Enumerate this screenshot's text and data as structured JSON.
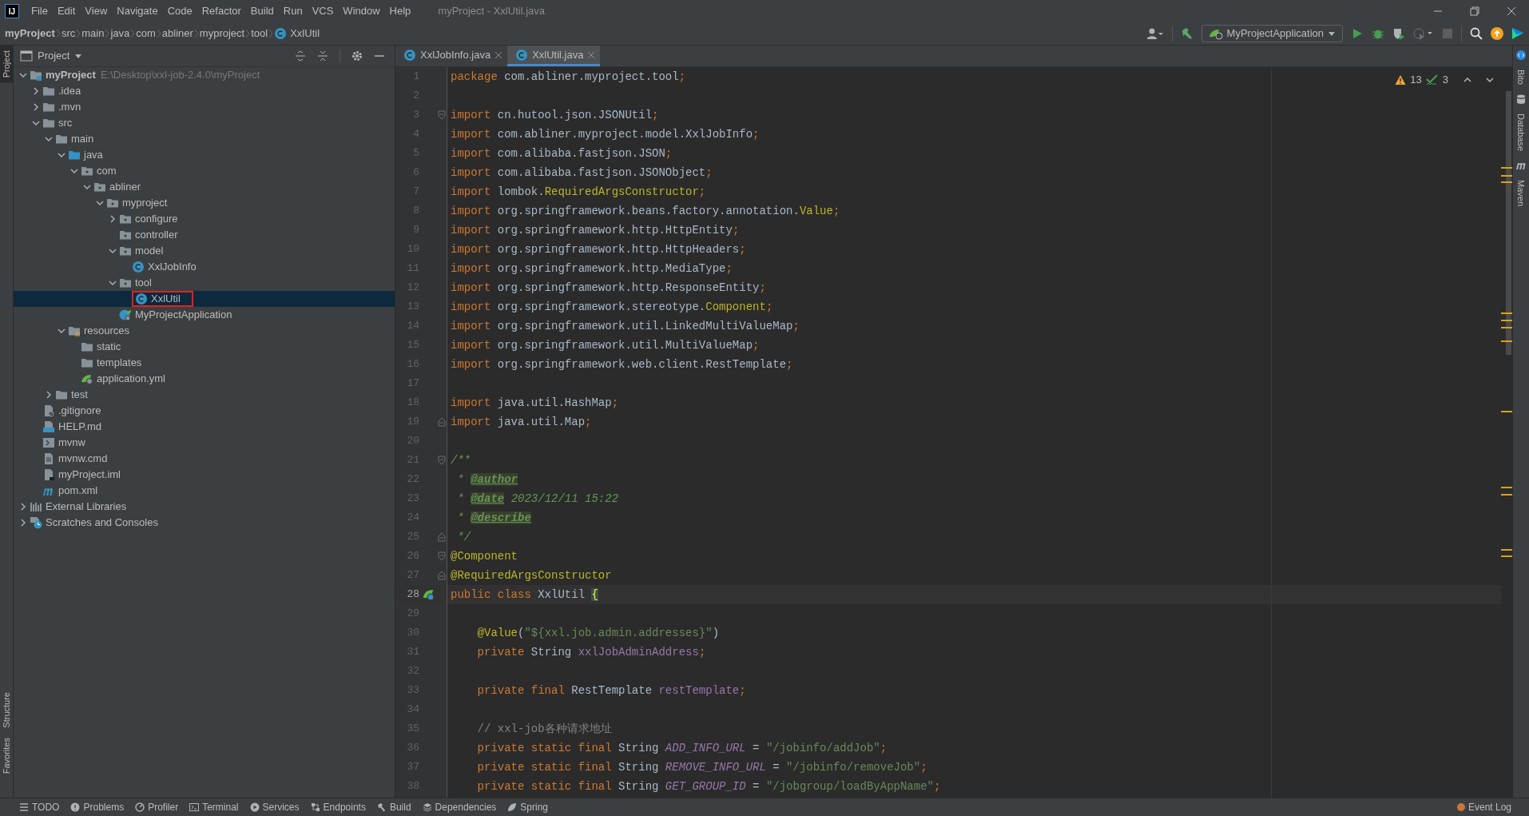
{
  "window": {
    "logo": "IJ",
    "title": "myProject - XxlUtil.java"
  },
  "menu": [
    "File",
    "Edit",
    "View",
    "Navigate",
    "Code",
    "Refactor",
    "Build",
    "Run",
    "VCS",
    "Window",
    "Help"
  ],
  "breadcrumbs": [
    {
      "label": "myProject",
      "kind": "project"
    },
    {
      "label": "src",
      "kind": "folder"
    },
    {
      "label": "main",
      "kind": "folder"
    },
    {
      "label": "java",
      "kind": "folder"
    },
    {
      "label": "com",
      "kind": "folder"
    },
    {
      "label": "abliner",
      "kind": "folder"
    },
    {
      "label": "myproject",
      "kind": "folder"
    },
    {
      "label": "tool",
      "kind": "folder"
    },
    {
      "label": "XxlUtil",
      "kind": "class"
    }
  ],
  "run_config": {
    "label": "MyProjectApplication"
  },
  "left_stripe_top": [
    {
      "label": "Project",
      "selected": true
    }
  ],
  "left_stripe_bottom": [
    {
      "label": "Structure",
      "selected": false
    },
    {
      "label": "Favorites",
      "selected": false
    }
  ],
  "right_stripe": [
    {
      "label": "Bito",
      "kind": "bito"
    },
    {
      "label": "Database",
      "kind": "database"
    },
    {
      "label": "Maven",
      "kind": "maven"
    }
  ],
  "project_panel": {
    "title": "Project",
    "tree": [
      {
        "label": "myProject",
        "kind": "module",
        "hint": "E:\\Desktop\\xxl-job-2.4.0\\myProject",
        "expanded": true,
        "selected": false,
        "boxed": false,
        "children": [
          {
            "label": ".idea",
            "kind": "folder",
            "expanded": false,
            "selected": false,
            "boxed": false
          },
          {
            "label": ".mvn",
            "kind": "folder",
            "expanded": false,
            "selected": false,
            "boxed": false
          },
          {
            "label": "src",
            "kind": "folder",
            "expanded": true,
            "selected": false,
            "boxed": false,
            "children": [
              {
                "label": "main",
                "kind": "folder",
                "expanded": true,
                "selected": false,
                "boxed": false,
                "children": [
                  {
                    "label": "java",
                    "kind": "source",
                    "expanded": true,
                    "selected": false,
                    "boxed": false,
                    "children": [
                      {
                        "label": "com",
                        "kind": "package",
                        "expanded": true,
                        "selected": false,
                        "boxed": false,
                        "children": [
                          {
                            "label": "abliner",
                            "kind": "package",
                            "expanded": true,
                            "selected": false,
                            "boxed": false,
                            "children": [
                              {
                                "label": "myproject",
                                "kind": "package",
                                "expanded": true,
                                "selected": false,
                                "boxed": false,
                                "children": [
                                  {
                                    "label": "configure",
                                    "kind": "package",
                                    "expanded": false,
                                    "selected": false,
                                    "boxed": false
                                  },
                                  {
                                    "label": "controller",
                                    "kind": "package",
                                    "selected": false,
                                    "boxed": false
                                  },
                                  {
                                    "label": "model",
                                    "kind": "package",
                                    "expanded": true,
                                    "selected": false,
                                    "boxed": false,
                                    "children": [
                                      {
                                        "label": "XxlJobInfo",
                                        "kind": "class",
                                        "selected": false,
                                        "boxed": false
                                      }
                                    ]
                                  },
                                  {
                                    "label": "tool",
                                    "kind": "package",
                                    "expanded": true,
                                    "selected": false,
                                    "boxed": false,
                                    "children": [
                                      {
                                        "label": "XxlUtil",
                                        "kind": "class",
                                        "selected": true,
                                        "boxed": true
                                      }
                                    ]
                                  },
                                  {
                                    "label": "MyProjectApplication",
                                    "kind": "spring",
                                    "selected": false,
                                    "boxed": false
                                  }
                                ]
                              }
                            ]
                          }
                        ]
                      }
                    ]
                  },
                  {
                    "label": "resources",
                    "kind": "resources",
                    "expanded": true,
                    "selected": false,
                    "boxed": false,
                    "children": [
                      {
                        "label": "static",
                        "kind": "folder",
                        "selected": false,
                        "boxed": false
                      },
                      {
                        "label": "templates",
                        "kind": "folder",
                        "selected": false,
                        "boxed": false
                      },
                      {
                        "label": "application.yml",
                        "kind": "yml",
                        "selected": false,
                        "boxed": false
                      }
                    ]
                  }
                ]
              },
              {
                "label": "test",
                "kind": "folder",
                "expanded": false,
                "selected": false,
                "boxed": false
              }
            ]
          },
          {
            "label": ".gitignore",
            "kind": "ignore",
            "selected": false,
            "boxed": false
          },
          {
            "label": "HELP.md",
            "kind": "markdown",
            "selected": false,
            "boxed": false
          },
          {
            "label": "mvnw",
            "kind": "script",
            "selected": false,
            "boxed": false
          },
          {
            "label": "mvnw.cmd",
            "kind": "text",
            "selected": false,
            "boxed": false
          },
          {
            "label": "myProject.iml",
            "kind": "iml",
            "selected": false,
            "boxed": false
          },
          {
            "label": "pom.xml",
            "kind": "maven",
            "selected": false,
            "boxed": false
          }
        ]
      },
      {
        "label": "External Libraries",
        "kind": "libraries",
        "expanded": false,
        "selected": false,
        "boxed": false
      },
      {
        "label": "Scratches and Consoles",
        "kind": "scratches",
        "expanded": false,
        "selected": false,
        "boxed": false
      }
    ]
  },
  "editor": {
    "tabs": [
      {
        "label": "XxlJobInfo.java",
        "selected": false
      },
      {
        "label": "XxlUtil.java",
        "selected": true
      }
    ],
    "warnings": "13",
    "typos": "3",
    "lines": [
      {
        "number": "1",
        "current": false,
        "tokens": [
          {
            "text": "package ",
            "kind": "keyword"
          },
          {
            "text": "com.abliner.myproject.tool",
            "kind": "plain"
          },
          {
            "text": ";",
            "kind": "keyword"
          }
        ]
      },
      {
        "number": "2",
        "current": false,
        "kind": "code"
      },
      {
        "number": "3",
        "current": false,
        "kind": "fold-start",
        "tokens": [
          {
            "text": "import ",
            "kind": "keyword"
          },
          {
            "text": "cn.hutool.json.JSONUtil",
            "kind": "plain"
          },
          {
            "text": ";",
            "kind": "keyword"
          }
        ]
      },
      {
        "number": "4",
        "current": false,
        "tokens": [
          {
            "text": "import ",
            "kind": "keyword"
          },
          {
            "text": "com.abliner.myproject.model.XxlJobInfo",
            "kind": "plain"
          },
          {
            "text": ";",
            "kind": "keyword"
          }
        ]
      },
      {
        "number": "5",
        "current": false,
        "tokens": [
          {
            "text": "import ",
            "kind": "keyword"
          },
          {
            "text": "com.alibaba.fastjson.JSON",
            "kind": "plain"
          },
          {
            "text": ";",
            "kind": "keyword"
          }
        ]
      },
      {
        "number": "6",
        "current": false,
        "tokens": [
          {
            "text": "import ",
            "kind": "keyword"
          },
          {
            "text": "com.alibaba.fastjson.JSONObject",
            "kind": "plain"
          },
          {
            "text": ";",
            "kind": "keyword"
          }
        ]
      },
      {
        "number": "7",
        "current": false,
        "tokens": [
          {
            "text": "import ",
            "kind": "keyword"
          },
          {
            "text": "lombok.",
            "kind": "plain"
          },
          {
            "text": "RequiredArgsConstructor",
            "kind": "annotation"
          },
          {
            "text": ";",
            "kind": "keyword"
          }
        ]
      },
      {
        "number": "8",
        "current": false,
        "tokens": [
          {
            "text": "import ",
            "kind": "keyword"
          },
          {
            "text": "org.springframework.beans.factory.annotation.",
            "kind": "plain"
          },
          {
            "text": "Value",
            "kind": "annotation"
          },
          {
            "text": ";",
            "kind": "keyword"
          }
        ]
      },
      {
        "number": "9",
        "current": false,
        "tokens": [
          {
            "text": "import ",
            "kind": "keyword"
          },
          {
            "text": "org.springframework.http.HttpEntity",
            "kind": "plain"
          },
          {
            "text": ";",
            "kind": "keyword"
          }
        ]
      },
      {
        "number": "10",
        "current": false,
        "tokens": [
          {
            "text": "import ",
            "kind": "keyword"
          },
          {
            "text": "org.springframework.http.HttpHeaders",
            "kind": "plain"
          },
          {
            "text": ";",
            "kind": "keyword"
          }
        ]
      },
      {
        "number": "11",
        "current": false,
        "tokens": [
          {
            "text": "import ",
            "kind": "keyword"
          },
          {
            "text": "org.springframework.http.MediaType",
            "kind": "plain"
          },
          {
            "text": ";",
            "kind": "keyword"
          }
        ]
      },
      {
        "number": "12",
        "current": false,
        "tokens": [
          {
            "text": "import ",
            "kind": "keyword"
          },
          {
            "text": "org.springframework.http.ResponseEntity",
            "kind": "plain"
          },
          {
            "text": ";",
            "kind": "keyword"
          }
        ]
      },
      {
        "number": "13",
        "current": false,
        "tokens": [
          {
            "text": "import ",
            "kind": "keyword"
          },
          {
            "text": "org.springframework.stereotype.",
            "kind": "plain"
          },
          {
            "text": "Component",
            "kind": "annotation"
          },
          {
            "text": ";",
            "kind": "keyword"
          }
        ]
      },
      {
        "number": "14",
        "current": false,
        "tokens": [
          {
            "text": "import ",
            "kind": "keyword"
          },
          {
            "text": "org.springframework.util.LinkedMultiValueMap",
            "kind": "plain"
          },
          {
            "text": ";",
            "kind": "keyword"
          }
        ]
      },
      {
        "number": "15",
        "current": false,
        "tokens": [
          {
            "text": "import ",
            "kind": "keyword"
          },
          {
            "text": "org.springframework.util.MultiValueMap",
            "kind": "plain"
          },
          {
            "text": ";",
            "kind": "keyword"
          }
        ]
      },
      {
        "number": "16",
        "current": false,
        "tokens": [
          {
            "text": "import ",
            "kind": "keyword"
          },
          {
            "text": "org.springframework.web.client.RestTemplate",
            "kind": "plain"
          },
          {
            "text": ";",
            "kind": "keyword"
          }
        ]
      },
      {
        "number": "17",
        "current": false,
        "kind": "code"
      },
      {
        "number": "18",
        "current": false,
        "tokens": [
          {
            "text": "import ",
            "kind": "keyword"
          },
          {
            "text": "java.util.HashMap",
            "kind": "plain"
          },
          {
            "text": ";",
            "kind": "keyword"
          }
        ]
      },
      {
        "number": "19",
        "current": false,
        "kind": "fold-end",
        "tokens": [
          {
            "text": "import ",
            "kind": "keyword"
          },
          {
            "text": "java.util.Map",
            "kind": "plain"
          },
          {
            "text": ";",
            "kind": "keyword"
          }
        ]
      },
      {
        "number": "20",
        "current": false,
        "kind": "code"
      },
      {
        "number": "21",
        "current": false,
        "kind": "fold-start",
        "tokens": [
          {
            "text": "/**",
            "kind": "doc"
          }
        ]
      },
      {
        "number": "22",
        "current": false,
        "tokens": [
          {
            "text": " * ",
            "kind": "doc"
          },
          {
            "text": "@author",
            "kind": "doctag"
          }
        ]
      },
      {
        "number": "23",
        "current": false,
        "tokens": [
          {
            "text": " * ",
            "kind": "doc"
          },
          {
            "text": "@date",
            "kind": "doctag"
          },
          {
            "text": " 2023/12/11 15:22",
            "kind": "doc"
          }
        ]
      },
      {
        "number": "24",
        "current": false,
        "tokens": [
          {
            "text": " * ",
            "kind": "doc"
          },
          {
            "text": "@describe",
            "kind": "doctag"
          }
        ]
      },
      {
        "number": "25",
        "current": false,
        "kind": "fold-end",
        "tokens": [
          {
            "text": " */",
            "kind": "doc"
          }
        ]
      },
      {
        "number": "26",
        "current": false,
        "kind": "fold-start",
        "tokens": [
          {
            "text": "@Component",
            "kind": "annotation"
          }
        ]
      },
      {
        "number": "27",
        "current": false,
        "kind": "fold-end",
        "tokens": [
          {
            "text": "@RequiredArgsConstructor",
            "kind": "annotation"
          }
        ]
      },
      {
        "number": "28",
        "current": true,
        "kind": "bean",
        "tokens": [
          {
            "text": "public class ",
            "kind": "keyword"
          },
          {
            "text": "XxlUtil ",
            "kind": "plain"
          },
          {
            "text": "{",
            "kind": "brace"
          }
        ]
      },
      {
        "number": "29",
        "current": false,
        "kind": "code"
      },
      {
        "number": "30",
        "current": false,
        "kind": "code",
        "tokens": [
          {
            "text": "    @Value",
            "kind": "annotation"
          },
          {
            "text": "(",
            "kind": "plain"
          },
          {
            "text": "\"${xxl.job.admin.addresses}\"",
            "kind": "string"
          },
          {
            "text": ")",
            "kind": "plain"
          }
        ]
      },
      {
        "number": "31",
        "current": false,
        "tokens": [
          {
            "text": "    private ",
            "kind": "keyword"
          },
          {
            "text": "String ",
            "kind": "plain"
          },
          {
            "text": "xxlJobAdminAddress",
            "kind": "field"
          },
          {
            "text": ";",
            "kind": "keyword"
          }
        ]
      },
      {
        "number": "32",
        "current": false,
        "kind": "code"
      },
      {
        "number": "33",
        "current": false,
        "tokens": [
          {
            "text": "    private final ",
            "kind": "keyword"
          },
          {
            "text": "RestTemplate ",
            "kind": "plain"
          },
          {
            "text": "restTemplate",
            "kind": "field"
          },
          {
            "text": ";",
            "kind": "keyword"
          }
        ]
      },
      {
        "number": "34",
        "current": false,
        "kind": "code"
      },
      {
        "number": "35",
        "current": false,
        "tokens": [
          {
            "text": "    // xxl-job各种请求地址",
            "kind": "comment"
          }
        ]
      },
      {
        "number": "36",
        "current": false,
        "tokens": [
          {
            "text": "    private static final ",
            "kind": "keyword"
          },
          {
            "text": "String ",
            "kind": "plain"
          },
          {
            "text": "ADD_INFO_URL",
            "kind": "constant"
          },
          {
            "text": " = ",
            "kind": "plain"
          },
          {
            "text": "\"/jobinfo/addJob\"",
            "kind": "string"
          },
          {
            "text": ";",
            "kind": "keyword"
          }
        ]
      },
      {
        "number": "37",
        "current": false,
        "tokens": [
          {
            "text": "    private static final ",
            "kind": "keyword"
          },
          {
            "text": "String ",
            "kind": "plain"
          },
          {
            "text": "REMOVE_INFO_URL",
            "kind": "constant"
          },
          {
            "text": " = ",
            "kind": "plain"
          },
          {
            "text": "\"/jobinfo/removeJob\"",
            "kind": "string"
          },
          {
            "text": ";",
            "kind": "keyword"
          }
        ]
      },
      {
        "number": "38",
        "current": false,
        "tokens": [
          {
            "text": "    private static final ",
            "kind": "keyword"
          },
          {
            "text": "String ",
            "kind": "plain"
          },
          {
            "text": "GET_GROUP_ID",
            "kind": "constant"
          },
          {
            "text": " = ",
            "kind": "plain"
          },
          {
            "text": "\"/jobgroup/loadByAppName\"",
            "kind": "string"
          },
          {
            "text": ";",
            "kind": "keyword"
          }
        ]
      }
    ]
  },
  "bottom_tools": [
    {
      "label": "TODO",
      "kind": "todo"
    },
    {
      "label": "Problems",
      "kind": "problems"
    },
    {
      "label": "Profiler",
      "kind": "profiler"
    },
    {
      "label": "Terminal",
      "kind": "terminal"
    },
    {
      "label": "Services",
      "kind": "services"
    },
    {
      "label": "Endpoints",
      "kind": "endpoints"
    },
    {
      "label": "Build",
      "kind": "build"
    },
    {
      "label": "Dependencies",
      "kind": "dependencies"
    },
    {
      "label": "Spring",
      "kind": "spring"
    }
  ],
  "event_log": {
    "label": "Event Log"
  }
}
